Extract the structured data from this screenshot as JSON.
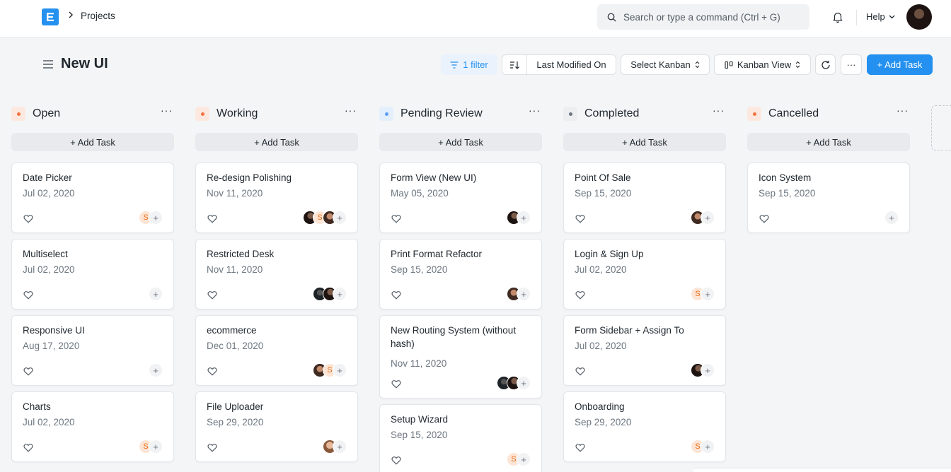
{
  "navbar": {
    "breadcrumb": "Projects",
    "search_placeholder": "Search or type a command (Ctrl + G)",
    "help_label": "Help"
  },
  "page": {
    "title": "New UI"
  },
  "toolbar": {
    "filter_label": "1 filter",
    "sort_label": "Last Modified On",
    "kanban_select_label": "Select Kanban",
    "view_label": "Kanban View",
    "add_task_label": "+ Add Task",
    "more_label": "···"
  },
  "colors": {
    "primary": "#2490ef",
    "open": "#f0743d",
    "working": "#f0743d",
    "pending_review": "#5b9ef0",
    "completed": "#6c7680",
    "cancelled": "#f0743d"
  },
  "column_add_label": "+ Add Task",
  "columns": [
    {
      "title": "Open",
      "cards": [
        {
          "title": "Date Picker",
          "date": "Jul 02, 2020",
          "avatars": [
            "S"
          ]
        },
        {
          "title": "Multiselect",
          "date": "Jul 02, 2020",
          "avatars": []
        },
        {
          "title": "Responsive UI",
          "date": "Aug 17, 2020",
          "avatars": []
        },
        {
          "title": "Charts",
          "date": "Jul 02, 2020",
          "avatars": [
            "S"
          ]
        }
      ]
    },
    {
      "title": "Working",
      "cards": [
        {
          "title": "Re-design Polishing",
          "date": "Nov 11, 2020",
          "avatars": [
            "photo-a",
            "S",
            "photo-b"
          ]
        },
        {
          "title": "Restricted Desk",
          "date": "Nov 11, 2020",
          "avatars": [
            "photo-c",
            "photo-a"
          ]
        },
        {
          "title": "ecommerce",
          "date": "Dec 01, 2020",
          "avatars": [
            "photo-b",
            "S"
          ]
        },
        {
          "title": "File Uploader",
          "date": "Sep 29, 2020",
          "avatars": [
            "photo-d"
          ]
        }
      ]
    },
    {
      "title": "Pending Review",
      "cards": [
        {
          "title": "Form View (New UI)",
          "date": "May 05, 2020",
          "avatars": [
            "photo-a"
          ]
        },
        {
          "title": "Print Format Refactor",
          "date": "Sep 15, 2020",
          "avatars": [
            "photo-b"
          ]
        },
        {
          "title": "New Routing System (without hash)",
          "date": "Nov 11, 2020",
          "avatars": [
            "photo-c",
            "photo-a"
          ]
        },
        {
          "title": "Setup Wizard",
          "date": "Sep 15, 2020",
          "avatars": [
            "S"
          ]
        }
      ]
    },
    {
      "title": "Completed",
      "cards": [
        {
          "title": "Point Of Sale",
          "date": "Sep 15, 2020",
          "avatars": [
            "photo-b"
          ]
        },
        {
          "title": "Login & Sign Up",
          "date": "Jul 02, 2020",
          "avatars": [
            "S"
          ]
        },
        {
          "title": "Form Sidebar + Assign To",
          "date": "Jul 02, 2020",
          "avatars": [
            "photo-a"
          ]
        },
        {
          "title": "Onboarding",
          "date": "Sep 29, 2020",
          "avatars": [
            "S"
          ]
        }
      ]
    },
    {
      "title": "Cancelled",
      "cards": [
        {
          "title": "Icon System",
          "date": "Sep 15, 2020",
          "avatars": []
        }
      ]
    }
  ]
}
